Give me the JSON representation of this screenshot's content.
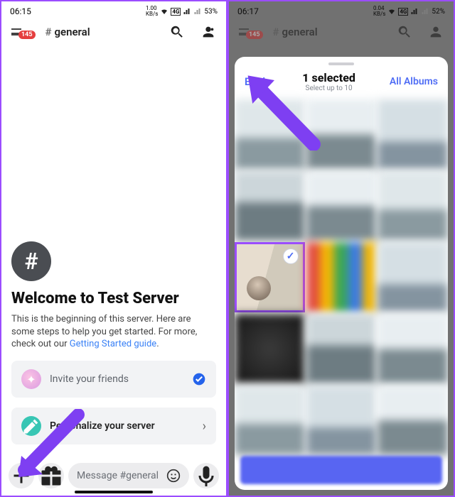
{
  "left": {
    "status": {
      "time": "06:15",
      "rate": "1.00",
      "kbs": "KB/s",
      "battery": "53%"
    },
    "header": {
      "badge": "145",
      "channel": "general"
    },
    "welcome": {
      "title": "Welcome to Test Server",
      "text_a": "This is the beginning of this server. Here are some steps to help you get started. For more, check out our ",
      "link": "Getting Started guide",
      "text_b": "."
    },
    "cards": {
      "invite": "Invite your friends",
      "personalize": "Personalize your server"
    },
    "composer": {
      "placeholder": "Message #general"
    }
  },
  "right": {
    "status": {
      "time": "06:17",
      "rate": "0.04",
      "kbs": "KB/s",
      "battery": "52%"
    },
    "header": {
      "badge": "145",
      "channel": "general"
    },
    "sheet": {
      "back": "Back",
      "title": "1 selected",
      "sub": "Select up to 10",
      "albums": "All Albums"
    }
  }
}
